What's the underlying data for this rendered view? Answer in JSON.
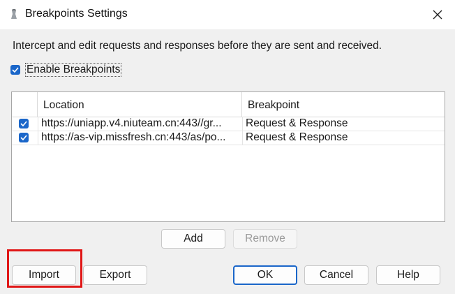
{
  "window": {
    "title": "Breakpoints Settings",
    "close_icon": "close-icon"
  },
  "description": "Intercept and edit requests and responses before they are sent and received.",
  "enable": {
    "label": "Enable Breakpoints",
    "checked": true
  },
  "table": {
    "columns": [
      "Location",
      "Breakpoint"
    ],
    "rows": [
      {
        "checked": true,
        "location": "https://uniapp.v4.niuteam.cn:443//gr...",
        "breakpoint": "Request & Response"
      },
      {
        "checked": true,
        "location": "https://as-vip.missfresh.cn:443/as/po...",
        "breakpoint": "Request & Response"
      }
    ]
  },
  "buttons": {
    "add": "Add",
    "remove": "Remove",
    "import": "Import",
    "export": "Export",
    "ok": "OK",
    "cancel": "Cancel",
    "help": "Help"
  },
  "colors": {
    "accent": "#1a66c9",
    "highlight": "#e01616"
  }
}
